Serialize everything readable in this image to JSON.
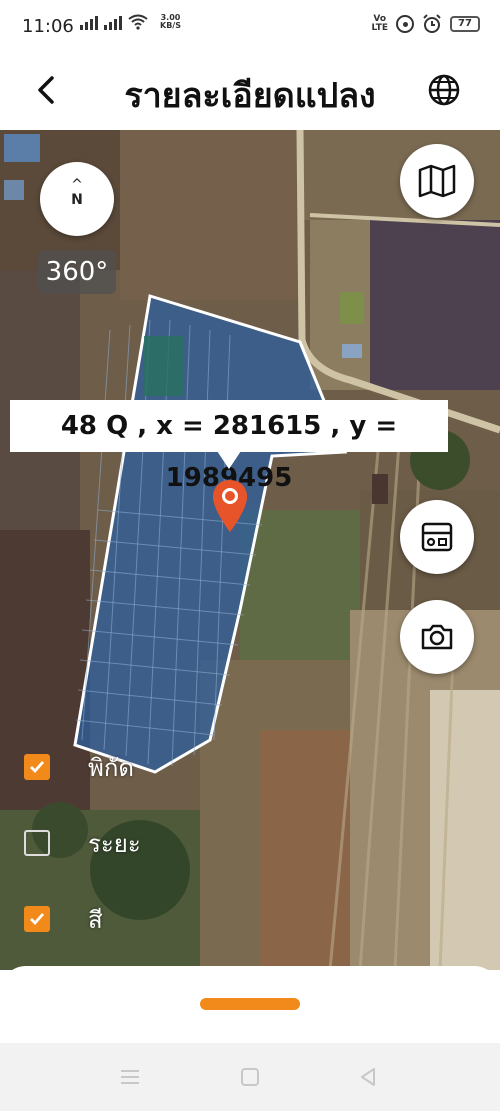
{
  "status_bar": {
    "time": "11:06",
    "speed_value": "3.00",
    "speed_unit": "KB/S",
    "volte_line1": "Vo",
    "volte_line2": "LTE",
    "battery": "77"
  },
  "header": {
    "title": "รายละเอียดแปลง",
    "back_icon": "chevron-left-icon",
    "globe_icon": "globe-icon"
  },
  "map": {
    "compass_arrow": "^",
    "compass_n": "N",
    "rotation": "360°",
    "coordinates": "48 Q , x = 281615 , y = 1989495",
    "icons": [
      "map-layers-icon",
      "radio-icon",
      "camera-icon"
    ]
  },
  "layers": [
    {
      "label": "พิกัด",
      "checked": true
    },
    {
      "label": "ระยะ",
      "checked": false
    },
    {
      "label": "สี",
      "checked": true
    }
  ],
  "colors": {
    "accent": "#f18a1b",
    "plot_fill": "#2f5f9a"
  }
}
